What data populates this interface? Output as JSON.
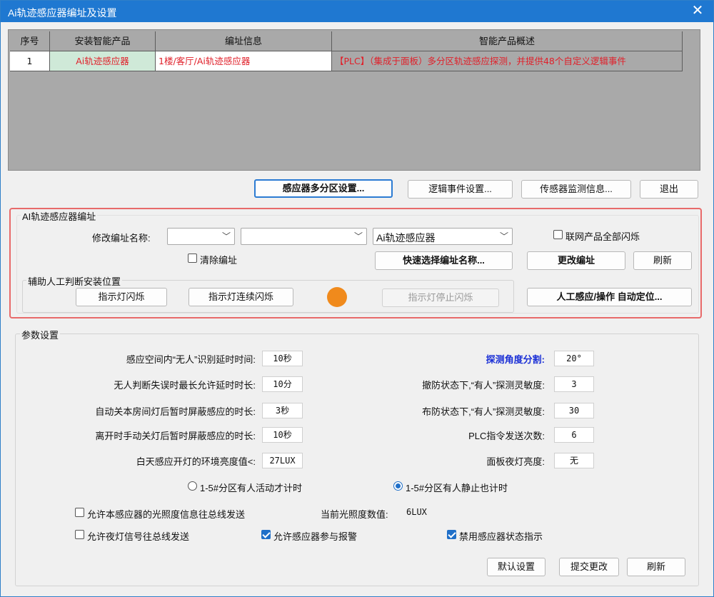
{
  "window": {
    "title": "Ai轨迹感应器编址及设置",
    "close": "✕"
  },
  "grid": {
    "headers": [
      "序号",
      "安装智能产品",
      "编址信息",
      "智能产品概述"
    ],
    "rows": [
      {
        "index": "1",
        "product": "Ai轨迹感应器",
        "address": "1楼/客厅/Ai轨迹感应器",
        "summary": "【PLC】（集成于面板）多分区轨迹感应探测，并提供48个自定义逻辑事件"
      }
    ]
  },
  "toolbar": {
    "zone_settings": "感应器多分区设置...",
    "logic_events": "逻辑事件设置...",
    "sensor_monitor": "传感器监测信息...",
    "exit": "退出"
  },
  "addressing": {
    "legend": "AI轨迹感应器编址",
    "modify_name_label": "修改编址名称:",
    "select1": "",
    "select2": "",
    "select3": "Ai轨迹感应器",
    "clear_address": "清除编址",
    "link_all_flash": "联网产品全部闪烁",
    "quick_select": "快速选择编址名称...",
    "change_address": "更改编址",
    "refresh": "刷新",
    "assist_legend": "辅助人工判断安装位置",
    "indicator_flash": "指示灯闪烁",
    "indicator_continuous": "指示灯连续闪烁",
    "indicator_stop": "指示灯停止闪烁",
    "manual_locate": "人工感应/操作  自动定位..."
  },
  "params": {
    "legend": "参数设置",
    "left": [
      {
        "label": "感应空间内“无人”识别延时时间:",
        "value": "10秒"
      },
      {
        "label": "无人判断失误时最长允许延时时长:",
        "value": "10分"
      },
      {
        "label": "自动关本房间灯后暂时屏蔽感应的时长:",
        "value": "3秒"
      },
      {
        "label": "离开时手动关灯后暂时屏蔽感应的时长:",
        "value": "10秒"
      },
      {
        "label": "白天感应开灯的环境亮度值<:",
        "value": "27LUX"
      }
    ],
    "right": [
      {
        "label": "探测角度分割:",
        "value": "20°"
      },
      {
        "label": "撤防状态下,“有人”探测灵敏度:",
        "value": "3"
      },
      {
        "label": "布防状态下,“有人”探测灵敏度:",
        "value": "30"
      },
      {
        "label": "PLC指令发送次数:",
        "value": "6"
      },
      {
        "label": "面板夜灯亮度:",
        "value": "无"
      }
    ],
    "radio1": "1-5#分区有人活动才计时",
    "radio2": "1-5#分区有人静止也计时",
    "allow_light_info": "允许本感应器的光照度信息往总线发送",
    "current_lux_label": "当前光照度数值:",
    "current_lux_value": "6LUX",
    "allow_nightlight": "允许夜灯信号往总线发送",
    "allow_alarm": "允许感应器参与报警",
    "disable_status": "禁用感应器状态指示",
    "default_btn": "默认设置",
    "submit_btn": "提交更改",
    "refresh_btn": "刷新"
  }
}
